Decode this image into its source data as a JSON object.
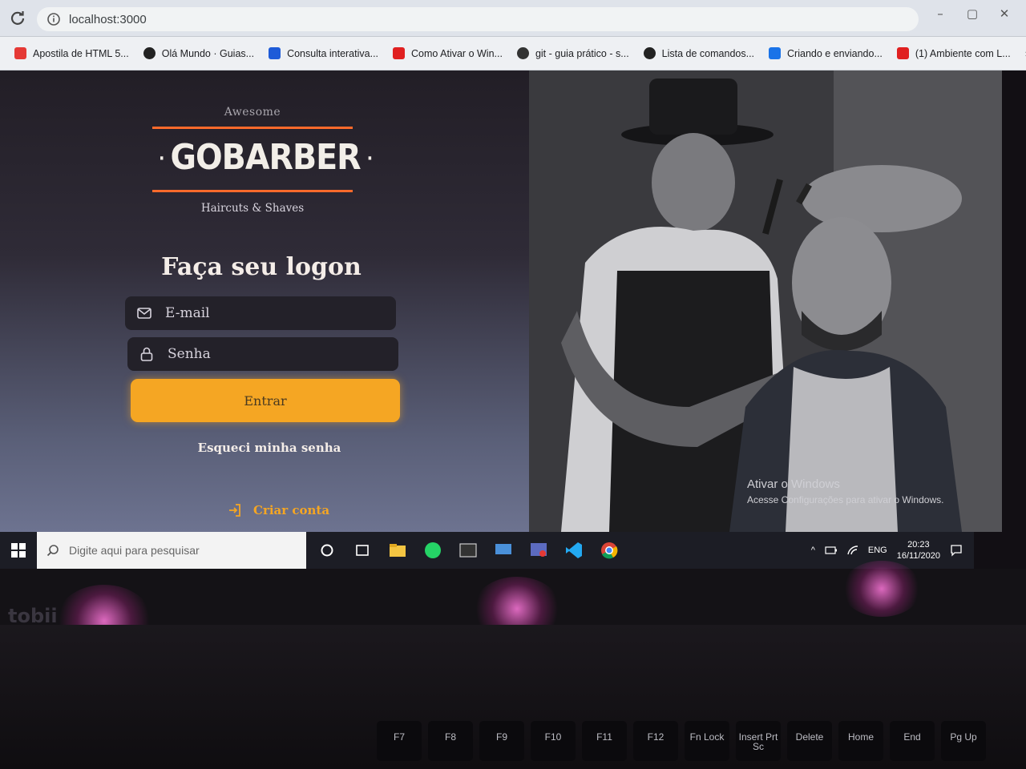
{
  "browser": {
    "url": "localhost:3000",
    "bookmarks": [
      {
        "label": "Apostila de HTML 5...",
        "color": "#e53935"
      },
      {
        "label": "Olá Mundo · Guias...",
        "color": "#222222"
      },
      {
        "label": "Consulta interativa...",
        "color": "#1e5bd8"
      },
      {
        "label": "Como Ativar o Win...",
        "color": "#e02020"
      },
      {
        "label": "git - guia prático - s...",
        "color": "#333333"
      },
      {
        "label": "Lista de comandos...",
        "color": "#222222"
      },
      {
        "label": "Criando e enviando...",
        "color": "#1a73e8"
      },
      {
        "label": "(1) Ambiente com L...",
        "color": "#e02020"
      }
    ],
    "more": "»"
  },
  "logo": {
    "top_text": "Awesome",
    "main_text": "GOBARBER",
    "dot": "·",
    "sub_text": "Haircuts & Shaves",
    "accent_color": "#ff6a2b"
  },
  "form": {
    "title": "Faça seu logon",
    "email_placeholder": "E-mail",
    "password_placeholder": "Senha",
    "submit_label": "Entrar",
    "forgot_label": "Esqueci minha senha",
    "create_label": "Criar conta",
    "button_color": "#f5a623"
  },
  "watermark": {
    "title": "Ativar o Windows",
    "subtitle": "Acesse Configurações para ativar o Windows."
  },
  "taskbar": {
    "search_placeholder": "Digite aqui para pesquisar",
    "language": "ENG",
    "time": "20:23",
    "date": "16/11/2020"
  },
  "device": {
    "brand": "tobii",
    "keys": [
      "F7",
      "F8",
      "F9",
      "F10",
      "F11",
      "F12",
      "Fn Lock",
      "Insert Prt Sc",
      "Delete",
      "Home",
      "End",
      "Pg Up"
    ]
  }
}
